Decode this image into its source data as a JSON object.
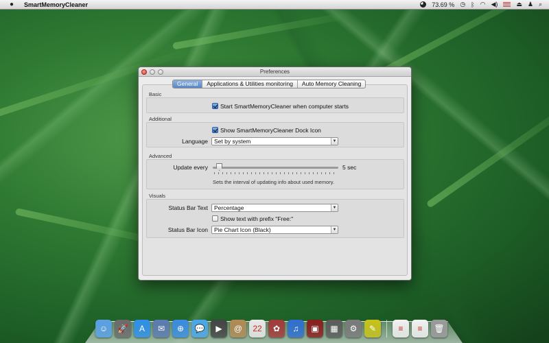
{
  "menubar": {
    "apple_icon": "apple-icon",
    "app_name": "SmartMemoryCleaner",
    "battery_percent": "73.69 %",
    "status_icons": [
      "pie-chart-icon",
      "time-machine-icon",
      "bluetooth-icon",
      "wifi-icon",
      "volume-icon",
      "flag-icon",
      "eject-icon",
      "user-icon",
      "spotlight-icon"
    ]
  },
  "window": {
    "title": "Preferences",
    "tabs": [
      {
        "label": "General",
        "active": true
      },
      {
        "label": "Applications & Utilities monitoring",
        "active": false
      },
      {
        "label": "Auto Memory Cleaning",
        "active": false
      }
    ]
  },
  "basic": {
    "section_label": "Basic",
    "start_on_boot": {
      "label": "Start SmartMemoryCleaner when computer starts",
      "checked": true
    }
  },
  "additional": {
    "section_label": "Additional",
    "show_dock_icon": {
      "label": "Show SmartMemoryCleaner Dock Icon",
      "checked": true
    },
    "language_label": "Language",
    "language_value": "Set by system"
  },
  "advanced": {
    "section_label": "Advanced",
    "update_label": "Update every",
    "update_value": "5 sec",
    "slider_fraction": 0.05,
    "hint": "Sets the interval of updating info about used memory."
  },
  "visuals": {
    "section_label": "Visuals",
    "status_bar_text_label": "Status Bar Text",
    "status_bar_text_value": "Percentage",
    "prefix_checkbox": {
      "label": "Show text with prefix \"Free:\"",
      "checked": false
    },
    "status_bar_icon_label": "Status Bar Icon",
    "status_bar_icon_value": "Pie Chart Icon (Black)"
  },
  "dock": {
    "icons": [
      {
        "name": "finder-icon",
        "color": "#5aa0e6",
        "glyph": "☺"
      },
      {
        "name": "launchpad-icon",
        "color": "#6b6b6b",
        "glyph": "🚀"
      },
      {
        "name": "app-store-icon",
        "color": "#2f8fe8",
        "glyph": "A"
      },
      {
        "name": "mail-stamp-icon",
        "color": "#5b7bb0",
        "glyph": "✉"
      },
      {
        "name": "safari-icon",
        "color": "#3a8ce0",
        "glyph": "⊕"
      },
      {
        "name": "messages-icon",
        "color": "#4aa7ea",
        "glyph": "💬"
      },
      {
        "name": "facetime-icon",
        "color": "#444444",
        "glyph": "▶"
      },
      {
        "name": "contacts-icon",
        "color": "#b08a55",
        "glyph": "@"
      },
      {
        "name": "calendar-icon",
        "color": "#e9e9e9",
        "glyph": "22"
      },
      {
        "name": "photo-booth-icon",
        "color": "#a33a3a",
        "glyph": "✿"
      },
      {
        "name": "itunes-icon",
        "color": "#2f6fd0",
        "glyph": "♫"
      },
      {
        "name": "photo-icon",
        "color": "#8a1f1f",
        "glyph": "▣"
      },
      {
        "name": "mission-control-icon",
        "color": "#5b5b5b",
        "glyph": "▦"
      },
      {
        "name": "system-preferences-icon",
        "color": "#7a7a7a",
        "glyph": "⚙"
      },
      {
        "name": "memory-cleaner-icon",
        "color": "#c8c21a",
        "glyph": "✎"
      }
    ],
    "right_icons": [
      {
        "name": "document-icon",
        "color": "#f2f2f2",
        "glyph": "≡"
      },
      {
        "name": "document-icon-2",
        "color": "#f2f2f2",
        "glyph": "≡"
      },
      {
        "name": "trash-icon",
        "color": "#9a9a9a",
        "glyph": "🗑"
      }
    ]
  }
}
